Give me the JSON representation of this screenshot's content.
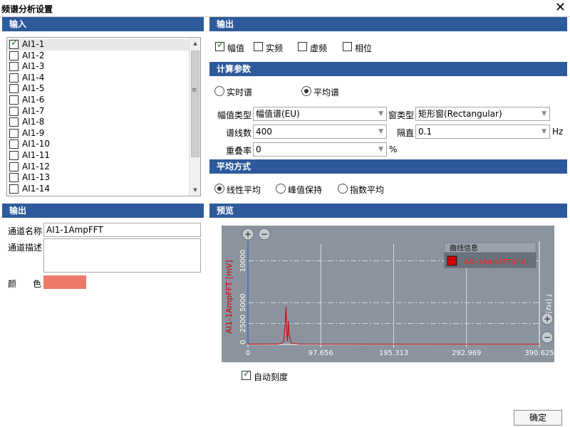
{
  "window": {
    "title": "频谱分析设置",
    "close_glyph": "✕"
  },
  "input_section": {
    "header": "输入",
    "channels": [
      {
        "label": "AI1-1",
        "checked": true
      },
      {
        "label": "AI1-2",
        "checked": false
      },
      {
        "label": "AI1-3",
        "checked": false
      },
      {
        "label": "AI1-4",
        "checked": false
      },
      {
        "label": "AI1-5",
        "checked": false
      },
      {
        "label": "AI1-6",
        "checked": false
      },
      {
        "label": "AI1-7",
        "checked": false
      },
      {
        "label": "AI1-8",
        "checked": false
      },
      {
        "label": "AI1-9",
        "checked": false
      },
      {
        "label": "AI1-10",
        "checked": false
      },
      {
        "label": "AI1-11",
        "checked": false
      },
      {
        "label": "AI1-12",
        "checked": false
      },
      {
        "label": "AI1-13",
        "checked": false
      },
      {
        "label": "AI1-14",
        "checked": false
      }
    ]
  },
  "output_section": {
    "header": "输出",
    "channel_name_label": "通道名称",
    "channel_name_value": "AI1-1AmpFFT",
    "channel_desc_label": "通道描述",
    "channel_desc_value": "",
    "color_label_1": "颜",
    "color_label_2": "色",
    "color_value": "#ee7b6a"
  },
  "output_types": {
    "header": "输出",
    "items": [
      {
        "label": "幅值",
        "checked": true
      },
      {
        "label": "实频",
        "checked": false
      },
      {
        "label": "虚频",
        "checked": false
      },
      {
        "label": "相位",
        "checked": false
      }
    ]
  },
  "calc_params": {
    "header": "计算参数",
    "mode_options": [
      {
        "label": "实时谱",
        "selected": false
      },
      {
        "label": "平均谱",
        "selected": true
      }
    ],
    "amp_type_label": "幅值类型",
    "amp_type_value": "幅值谱(EU)",
    "window_type_label": "窗类型",
    "window_type_value": "矩形窗(Rectangular)",
    "lines_label": "谱线数",
    "lines_value": "400",
    "spacing_label": "隔直",
    "spacing_value": "0.1",
    "spacing_unit": "Hz",
    "overlap_label": "重叠率",
    "overlap_value": "0",
    "overlap_unit": "%"
  },
  "average_method": {
    "header": "平均方式",
    "options": [
      {
        "label": "线性平均",
        "selected": true
      },
      {
        "label": "峰值保持",
        "selected": false
      },
      {
        "label": "指数平均",
        "selected": false
      }
    ]
  },
  "preview": {
    "header": "预览",
    "zoom_in_glyph": "+",
    "zoom_out_glyph": "−",
    "legend_title": "曲线信息",
    "legend_entry": "AI1-1AmpFFT[mV]",
    "y_axis_label": "AI1-1AmpFFT [mV]",
    "x_axis_label": "f [Hz]",
    "auto_scale_label": "自动刻度",
    "auto_scale_checked": true
  },
  "chart_data": {
    "type": "line",
    "x_ticks": [
      "0",
      "97.656",
      "195.313",
      "292.969",
      "390.625"
    ],
    "y_ticks": [
      "0",
      "2500",
      "5000",
      "10000"
    ],
    "xlim": [
      0,
      390.625
    ],
    "ylim": [
      0,
      12000
    ],
    "series": [
      {
        "name": "AI1-1AmpFFT[mV]",
        "color": "#cc0000",
        "x": [
          0,
          40,
          45,
          48,
          49,
          50,
          51,
          52,
          53,
          54,
          55,
          58,
          70,
          390.625
        ],
        "y": [
          30,
          40,
          120,
          400,
          1500,
          2700,
          4500,
          1500,
          400,
          2800,
          1200,
          150,
          40,
          20
        ]
      }
    ],
    "grid": true,
    "legend": "top-right"
  },
  "buttons": {
    "ok": "确定"
  }
}
